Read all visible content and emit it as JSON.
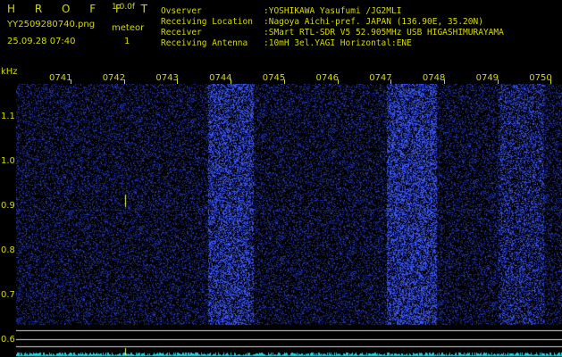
{
  "header": {
    "app_title": "H R O F F T",
    "version": "1.0.0f",
    "filename": "YY2509280740.png",
    "datetime": "25.09.28 07:40",
    "meteor_label": "meteor",
    "meteor_count": "1"
  },
  "info": [
    {
      "label": "Ovserver",
      "value": ":YOSHIKAWA Yasufumi /JG2MLI"
    },
    {
      "label": "Receiving Location",
      "value": ":Nagoya Aichi-pref. JAPAN (136.90E, 35.20N)"
    },
    {
      "label": "Receiver",
      "value": ":SMart RTL-SDR V5 52.905MHz USB HIGASHIMURAYAMA"
    },
    {
      "label": "Receiving Antenna",
      "value": ":10mH 3el.YAGI Horizontal:ENE"
    }
  ],
  "axis": {
    "unit": "kHz",
    "y_ticks": [
      "1.1",
      "1.0",
      "0.9",
      "0.8",
      "0.7",
      "0.6"
    ],
    "x_ticks": [
      "0741",
      "0742",
      "0743",
      "0744",
      "0745",
      "0746",
      "0747",
      "0748",
      "0749",
      "0750"
    ]
  },
  "colors": {
    "text": "#d8d800",
    "background": "#000000",
    "noise": "#1e2a9a",
    "signal": "#20d0e0",
    "meteor": "#e8ff60",
    "guide_lines": "#d8d8d8"
  }
}
